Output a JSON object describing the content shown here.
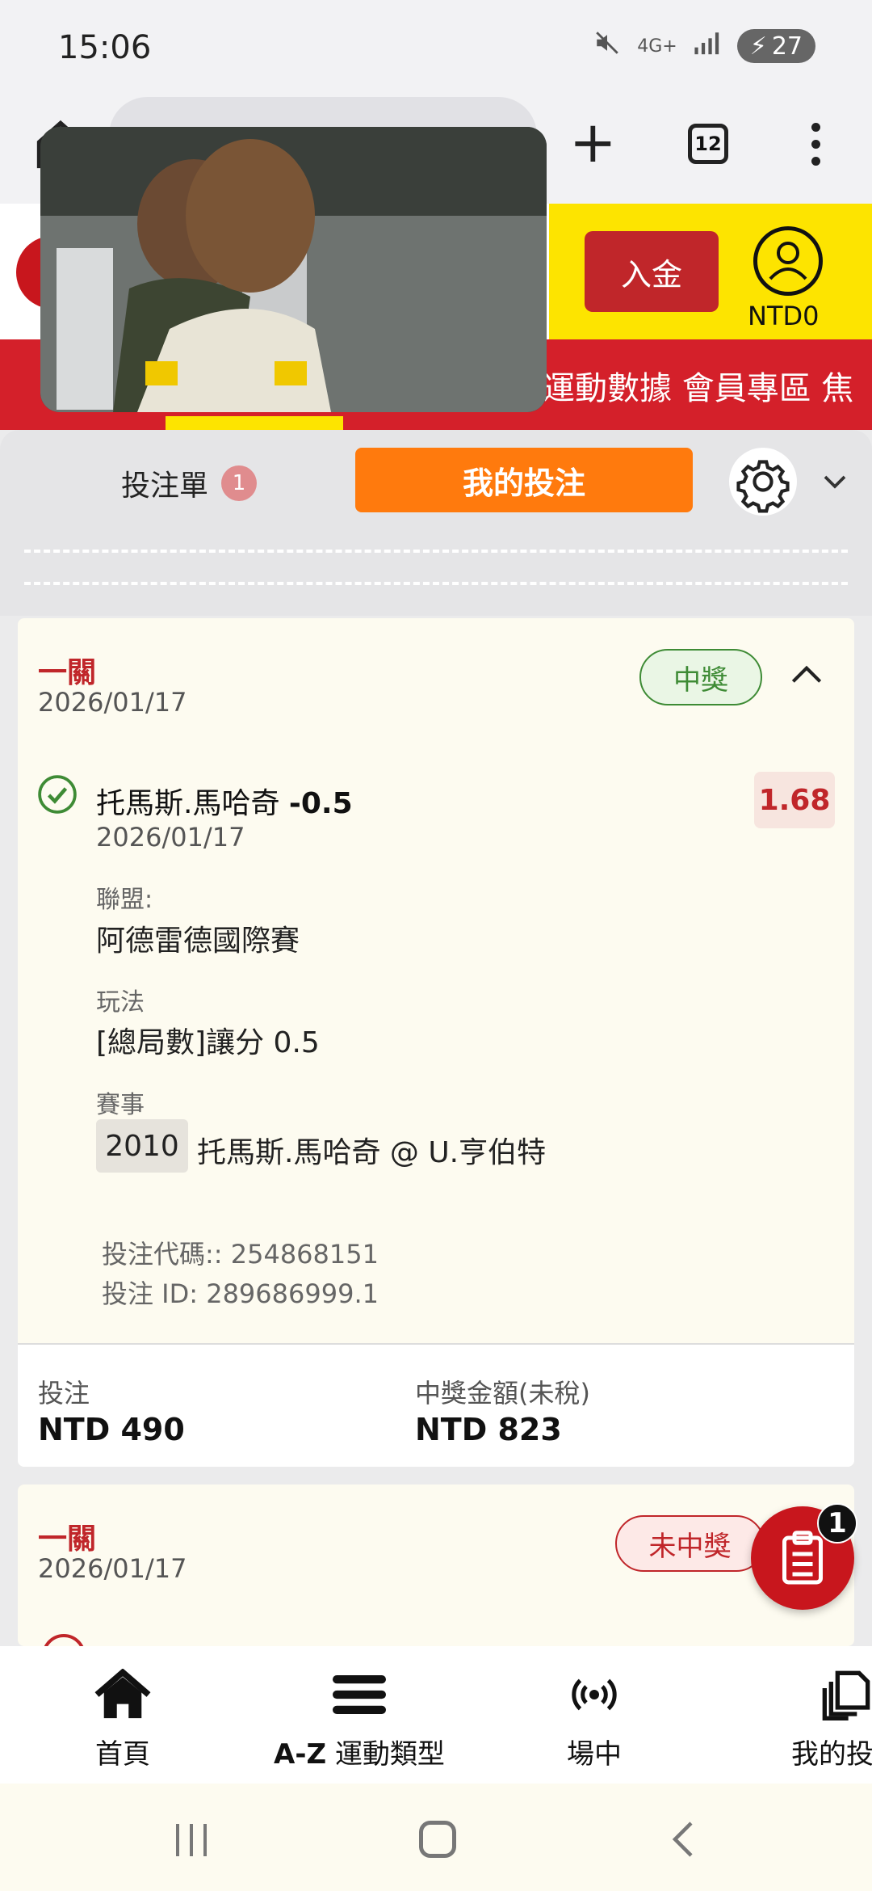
{
  "status_bar": {
    "time": "15:06",
    "network": "4G+",
    "battery": "27"
  },
  "browser": {
    "tab_count": "12"
  },
  "header": {
    "deposit_label": "入金",
    "balance": "NTD0",
    "nav_text": "運動數據 會員專區 焦"
  },
  "slip_bar": {
    "bet_slip_label": "投注單",
    "bet_slip_count": "1",
    "my_bets_label": "我的投注"
  },
  "bets": [
    {
      "type": "一關",
      "date": "2026/01/17",
      "status": "中獎",
      "selection_name": "托馬斯.馬哈奇",
      "selection_handicap": "-0.5",
      "odds": "1.68",
      "selection_date": "2026/01/17",
      "league_label": "聯盟:",
      "league": "阿德雷德國際賽",
      "market_label": "玩法",
      "market": "[總局數]讓分 0.5",
      "event_label": "賽事",
      "event_id": "2010",
      "event_name": "托馬斯.馬哈奇 @ U.亨伯特",
      "bet_code": "投注代碼:: 254868151",
      "bet_id": "投注 ID: 289686999.1",
      "stake_label": "投注",
      "stake": "NTD 490",
      "payout_label": "中獎金額(未稅)",
      "payout": "NTD 823"
    },
    {
      "type": "一關",
      "date": "2026/01/17",
      "status": "未中獎"
    }
  ],
  "floating_slip_count": "1",
  "bottom_nav": [
    {
      "label": "首頁",
      "icon": "home-icon"
    },
    {
      "label_bold": "A-Z",
      "label": "運動類型",
      "icon": "list-icon"
    },
    {
      "label": "場中",
      "icon": "live-icon"
    },
    {
      "label": "我的投注",
      "icon": "copy-icon"
    }
  ],
  "colors": {
    "brand_red": "#c8161d",
    "accent_orange": "#ff7a0d",
    "header_yellow": "#fde400",
    "win_green": "#3e8b35"
  }
}
